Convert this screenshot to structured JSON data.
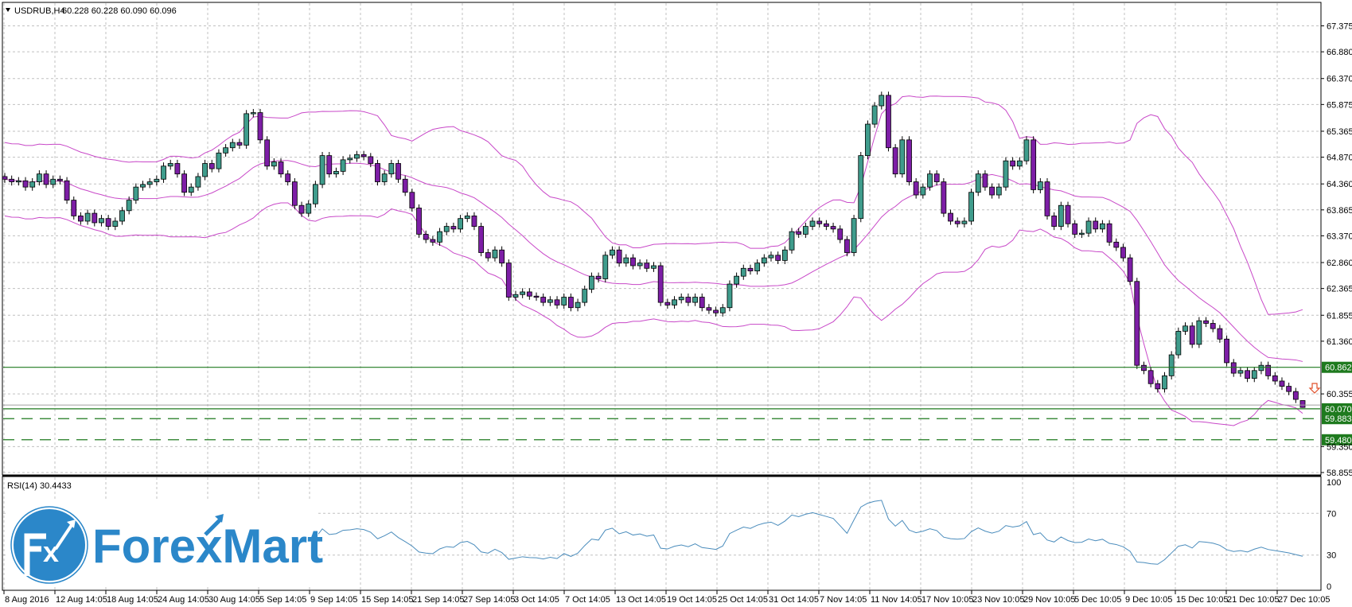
{
  "header": {
    "symbol": "USDRUB,H4",
    "ohlc": "60.228 60.228 60.090 60.096"
  },
  "rsi_panel": {
    "label": "RSI(14) 30.4433",
    "ticks": [
      "100",
      "70",
      "30",
      "0"
    ],
    "tick_values": [
      100,
      70,
      30,
      0
    ]
  },
  "logo": {
    "mark": "Fx",
    "text": "ForexMart"
  },
  "colors": {
    "bull": "#3f9c8c",
    "bear": "#7d1ea6",
    "bands": "#c848c8",
    "rsi": "#4a8cbc",
    "level": "#1e7a1e",
    "grid": "#c0c0c0",
    "arrow": "#e0502a",
    "logo": "#2b87c9"
  },
  "icons": {
    "header_toggle": "triangle-down-icon",
    "signal": "sell-arrow-down-icon"
  },
  "chart_data": {
    "type": "candlestick",
    "title": "USDRUB,H4",
    "indicators": [
      "Bollinger Bands",
      "RSI(14)"
    ],
    "ylim": [
      58.855,
      67.375
    ],
    "y_ticks": [
      "67.375",
      "66.880",
      "66.370",
      "65.875",
      "65.365",
      "64.870",
      "64.360",
      "63.865",
      "63.370",
      "62.860",
      "62.365",
      "61.855",
      "61.360",
      "60.355",
      "59.350",
      "58.855"
    ],
    "y_tick_values": [
      67.375,
      66.88,
      66.37,
      65.875,
      65.365,
      64.87,
      64.36,
      63.865,
      63.37,
      62.86,
      62.365,
      61.855,
      61.36,
      60.355,
      59.35,
      58.855
    ],
    "x_labels": [
      "8 Aug 2016",
      "12 Aug 14:05",
      "18 Aug 14:05",
      "24 Aug 14:05",
      "30 Aug 14:05",
      "5 Sep 14:05",
      "9 Sep 14:05",
      "15 Sep 14:05",
      "21 Sep 14:05",
      "27 Sep 14:05",
      "3 Oct 14:05",
      "7 Oct 14:05",
      "13 Oct 14:05",
      "19 Oct 14:05",
      "25 Oct 14:05",
      "31 Oct 14:05",
      "7 Nov 14:05",
      "11 Nov 14:05",
      "17 Nov 10:05",
      "23 Nov 10:05",
      "29 Nov 10:05",
      "5 Dec 10:05",
      "9 Dec 10:05",
      "15 Dec 10:05",
      "21 Dec 10:05",
      "27 Dec 10:05"
    ],
    "levels": [
      {
        "label": "60.862",
        "value": 60.862,
        "style": "solid"
      },
      {
        "label": "60.070",
        "value": 60.07,
        "style": "solid"
      },
      {
        "label": "59.883",
        "value": 59.883,
        "style": "dashed"
      },
      {
        "label": "59.480",
        "value": 59.48,
        "style": "dashed"
      }
    ],
    "current_price": 60.096,
    "close": [
      64.45,
      64.4,
      64.42,
      64.3,
      64.4,
      64.55,
      64.35,
      64.45,
      64.42,
      64.05,
      63.75,
      63.65,
      63.8,
      63.62,
      63.7,
      63.55,
      63.65,
      63.85,
      64.05,
      64.3,
      64.35,
      64.4,
      64.45,
      64.7,
      64.75,
      64.55,
      64.2,
      64.3,
      64.5,
      64.75,
      64.65,
      64.95,
      65.05,
      65.15,
      65.1,
      65.7,
      65.72,
      65.2,
      64.7,
      64.78,
      64.55,
      64.4,
      63.95,
      63.8,
      63.98,
      64.35,
      64.9,
      64.55,
      64.6,
      64.82,
      64.85,
      64.92,
      64.88,
      64.75,
      64.4,
      64.55,
      64.75,
      64.45,
      64.2,
      63.9,
      63.4,
      63.3,
      63.25,
      63.45,
      63.55,
      63.5,
      63.7,
      63.75,
      63.55,
      63.05,
      62.95,
      63.1,
      62.85,
      62.2,
      62.25,
      62.3,
      62.22,
      62.2,
      62.1,
      62.15,
      62.05,
      62.2,
      62.0,
      62.1,
      62.35,
      62.6,
      62.55,
      63.0,
      63.1,
      62.85,
      62.95,
      62.8,
      62.85,
      62.75,
      62.8,
      62.1,
      62.05,
      62.15,
      62.2,
      62.1,
      62.2,
      62.0,
      61.95,
      61.9,
      62.0,
      62.45,
      62.6,
      62.75,
      62.7,
      62.85,
      62.95,
      63.0,
      62.9,
      63.1,
      63.45,
      63.4,
      63.55,
      63.65,
      63.6,
      63.55,
      63.5,
      63.3,
      63.05,
      63.7,
      64.9,
      65.5,
      65.85,
      66.05,
      65.05,
      64.55,
      65.2,
      64.4,
      64.15,
      64.3,
      64.55,
      64.4,
      63.8,
      63.65,
      63.6,
      63.65,
      64.2,
      64.55,
      64.3,
      64.15,
      64.3,
      64.8,
      64.7,
      64.8,
      65.2,
      64.25,
      64.4,
      63.75,
      63.55,
      63.95,
      63.6,
      63.4,
      63.42,
      63.65,
      63.5,
      63.6,
      63.25,
      63.15,
      62.95,
      62.5,
      60.9,
      60.8,
      60.55,
      60.45,
      60.7,
      61.1,
      61.55,
      61.65,
      61.3,
      61.75,
      61.7,
      61.6,
      61.4,
      60.95,
      60.75,
      60.8,
      60.65,
      60.8,
      60.9,
      60.7,
      60.6,
      60.5,
      60.4,
      60.25,
      60.096
    ],
    "last_bar": {
      "open": 60.228,
      "high": 60.228,
      "low": 60.09,
      "close": 60.096
    }
  }
}
